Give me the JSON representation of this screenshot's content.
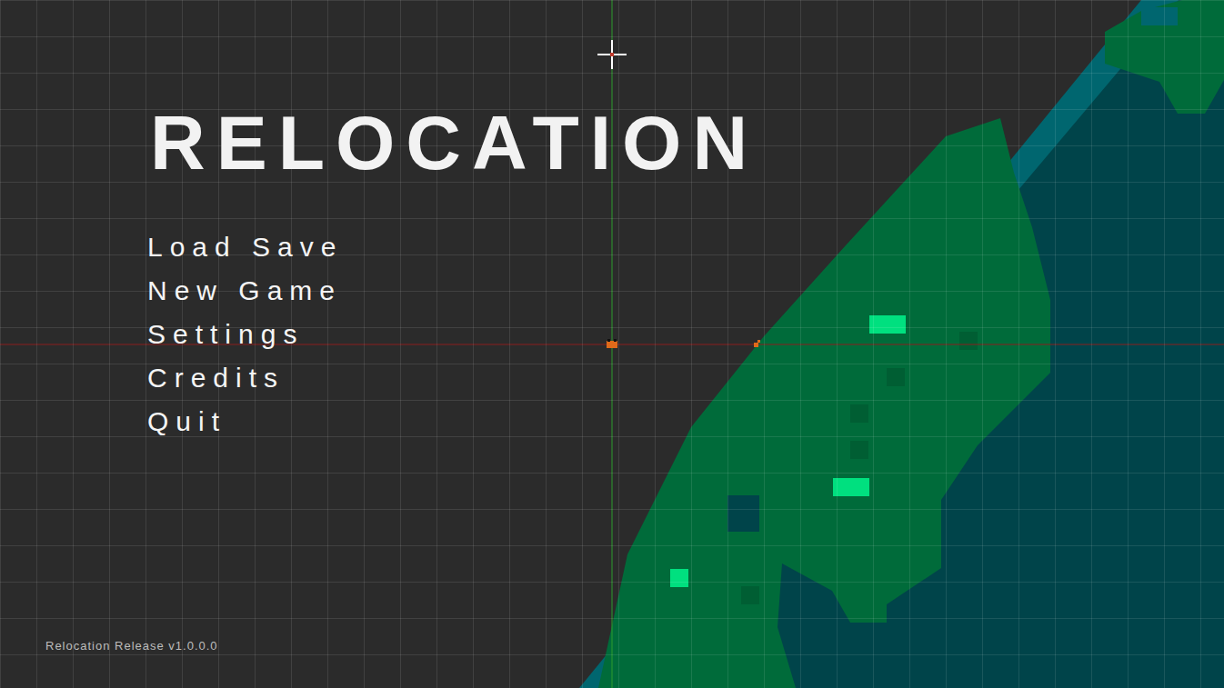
{
  "title": "RELOCATION",
  "menu": [
    {
      "label": "Load Save"
    },
    {
      "label": "New Game"
    },
    {
      "label": "Settings"
    },
    {
      "label": "Credits"
    },
    {
      "label": "Quit"
    }
  ],
  "version": "Relocation Release v1.0.0.0"
}
